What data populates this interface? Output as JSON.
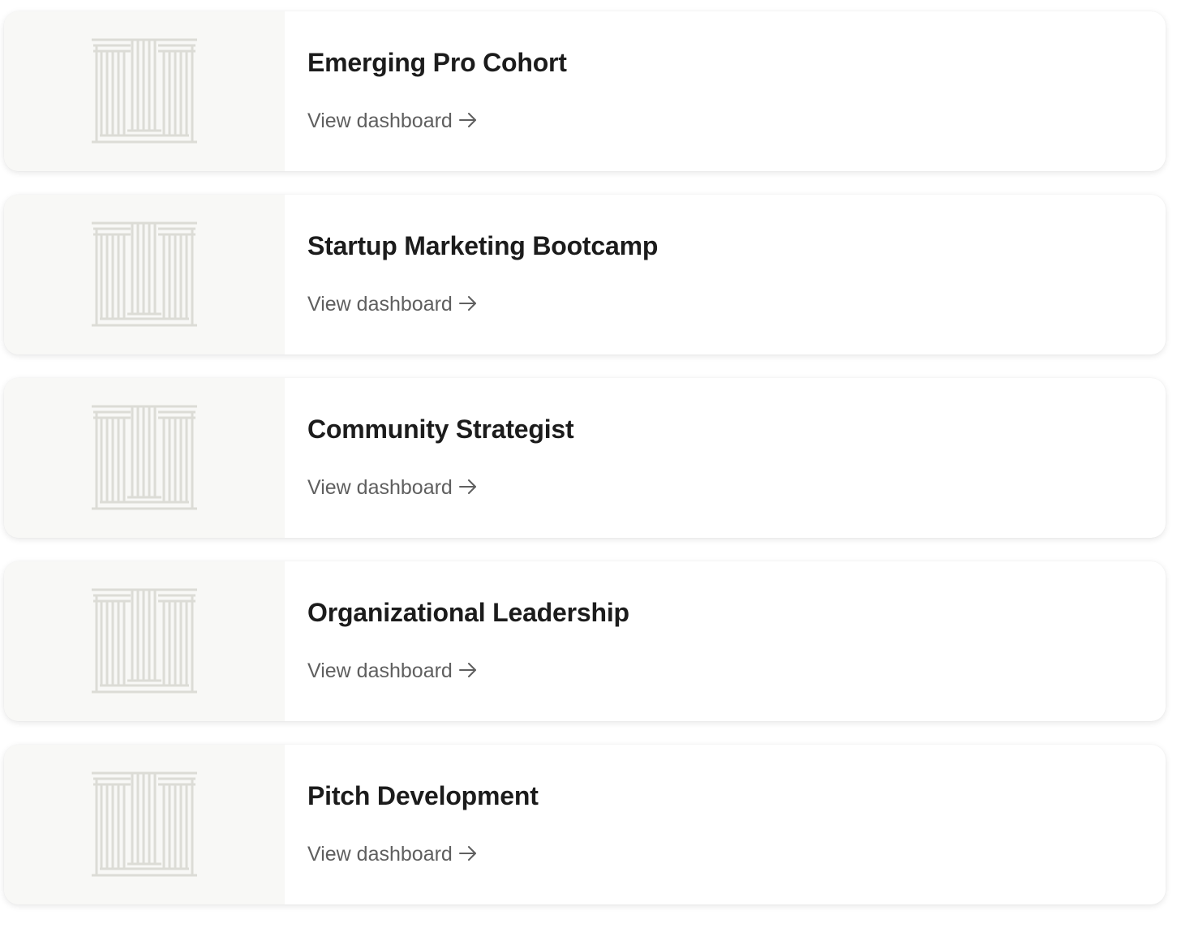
{
  "courses": [
    {
      "title": "Emerging Pro Cohort",
      "link_label": "View dashboard",
      "icon": "pillars-icon"
    },
    {
      "title": "Startup Marketing Bootcamp",
      "link_label": "View dashboard",
      "icon": "pillars-icon"
    },
    {
      "title": "Community Strategist",
      "link_label": "View dashboard",
      "icon": "pillars-icon"
    },
    {
      "title": "Organizational Leadership",
      "link_label": "View dashboard",
      "icon": "pillars-icon"
    },
    {
      "title": "Pitch Development",
      "link_label": "View dashboard",
      "icon": "pillars-icon"
    }
  ],
  "colors": {
    "thumb_bg": "#f8f8f6",
    "pillar_stroke": "#dcdcd6",
    "title": "#1c1c1c",
    "link": "#5f5f5f"
  }
}
